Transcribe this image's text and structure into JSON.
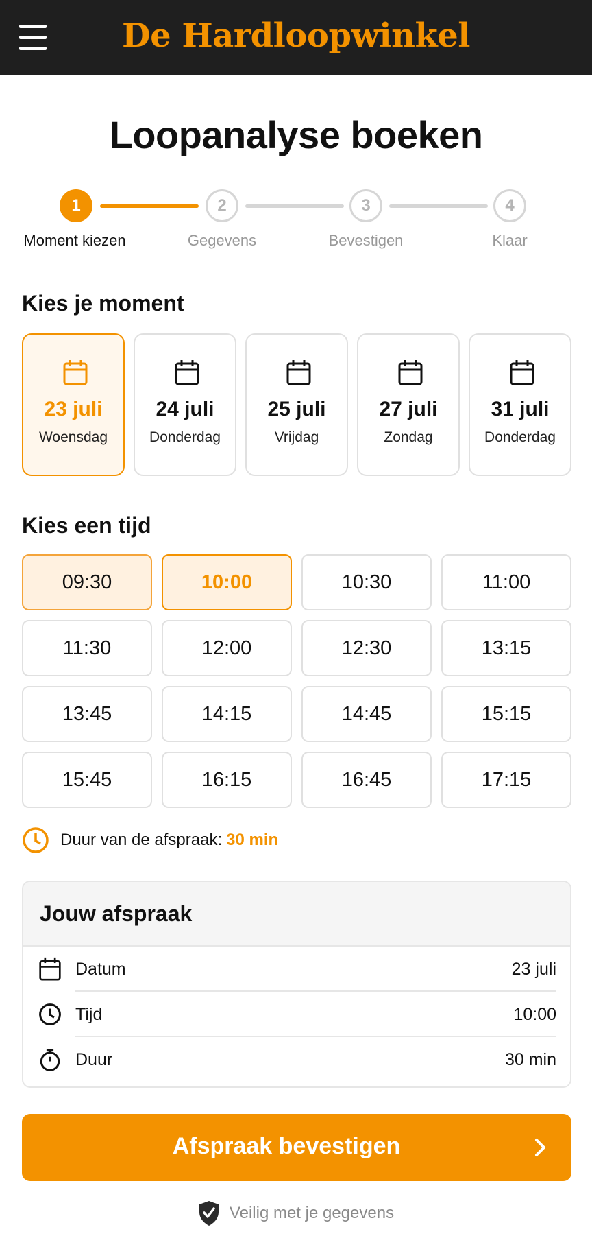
{
  "header": {
    "brand": "De Hardloopwinkel"
  },
  "page": {
    "title": "Loopanalyse boeken"
  },
  "stepper": {
    "steps": [
      {
        "number": "1",
        "label": "Moment kiezen",
        "active": true
      },
      {
        "number": "2",
        "label": "Gegevens",
        "active": false
      },
      {
        "number": "3",
        "label": "Bevestigen",
        "active": false
      },
      {
        "number": "4",
        "label": "Klaar",
        "active": false
      }
    ]
  },
  "moment": {
    "title": "Kies je moment",
    "dates": [
      {
        "date": "23 juli",
        "weekday": "Woensdag",
        "selected": true
      },
      {
        "date": "24 juli",
        "weekday": "Donderdag",
        "selected": false
      },
      {
        "date": "25 juli",
        "weekday": "Vrijdag",
        "selected": false
      },
      {
        "date": "27 juli",
        "weekday": "Zondag",
        "selected": false
      },
      {
        "date": "31 juli",
        "weekday": "Donderdag",
        "selected": false
      }
    ]
  },
  "time": {
    "title": "Kies een tijd",
    "slots": [
      "09:30",
      "10:00",
      "10:30",
      "11:00",
      "11:30",
      "12:00",
      "12:30",
      "13:15",
      "13:45",
      "14:15",
      "14:45",
      "15:15",
      "15:45",
      "16:15",
      "16:45",
      "17:15"
    ],
    "selected": "10:00",
    "highlighted": "09:30"
  },
  "duration": {
    "label": "Duur van de afspraak:",
    "value": "30 min"
  },
  "summary": {
    "title": "Jouw afspraak",
    "rows": [
      {
        "icon": "calendar-icon",
        "label": "Datum",
        "value": "23 juli"
      },
      {
        "icon": "clock-icon",
        "label": "Tijd",
        "value": "10:00"
      },
      {
        "icon": "stopwatch-icon",
        "label": "Duur",
        "value": "30 min"
      }
    ]
  },
  "cta": {
    "label": "Afspraak bevestigen",
    "icon": "chevron-right-icon"
  },
  "footer": {
    "secure_text": "Veilig met je gegevens",
    "icon": "shield-check-icon"
  },
  "colors": {
    "accent": "#f39200",
    "header_bg": "#1f1f1f",
    "selected_bg": "#fff1e0"
  }
}
